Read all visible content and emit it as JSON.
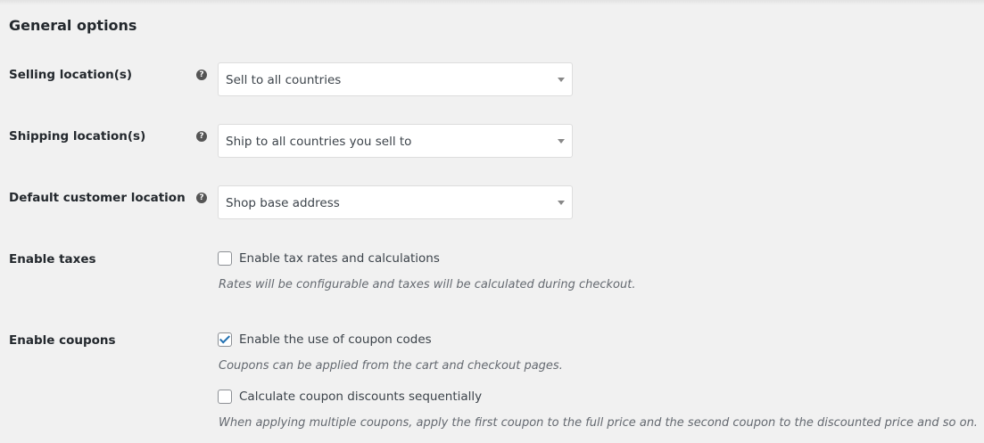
{
  "section": {
    "title": "General options"
  },
  "rows": {
    "selling": {
      "label": "Selling location(s)",
      "value": "Sell to all countries"
    },
    "shipping": {
      "label": "Shipping location(s)",
      "value": "Ship to all countries you sell to"
    },
    "customer": {
      "label": "Default customer location",
      "value": "Shop base address"
    },
    "taxes": {
      "label": "Enable taxes",
      "checkbox_label": "Enable tax rates and calculations",
      "checked": false,
      "description": "Rates will be configurable and taxes will be calculated during checkout."
    },
    "coupons": {
      "label": "Enable coupons",
      "checkbox_label": "Enable the use of coupon codes",
      "checked": true,
      "description": "Coupons can be applied from the cart and checkout pages.",
      "sequential_label": "Calculate coupon discounts sequentially",
      "sequential_checked": false,
      "sequential_description": "When applying multiple coupons, apply the first coupon to the full price and the second coupon to the discounted price and so on."
    }
  },
  "icons": {
    "help": "?"
  },
  "colors": {
    "background": "#f1f1f1",
    "accent": "#2271b1"
  }
}
